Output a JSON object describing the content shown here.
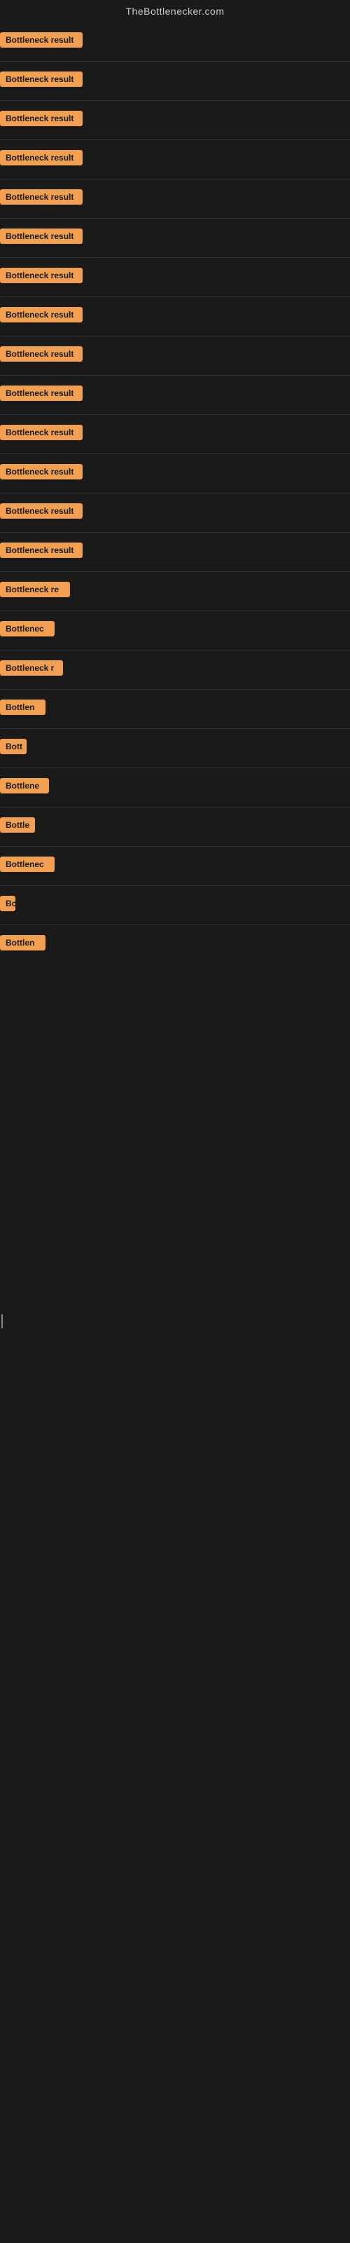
{
  "site": {
    "title": "TheBottlenecker.com"
  },
  "items": [
    {
      "id": 1,
      "label": "Bottleneck result",
      "badge_width": "full"
    },
    {
      "id": 2,
      "label": "Bottleneck result",
      "badge_width": "full"
    },
    {
      "id": 3,
      "label": "Bottleneck result",
      "badge_width": "full"
    },
    {
      "id": 4,
      "label": "Bottleneck result",
      "badge_width": "full"
    },
    {
      "id": 5,
      "label": "Bottleneck result",
      "badge_width": "full"
    },
    {
      "id": 6,
      "label": "Bottleneck result",
      "badge_width": "full"
    },
    {
      "id": 7,
      "label": "Bottleneck result",
      "badge_width": "full"
    },
    {
      "id": 8,
      "label": "Bottleneck result",
      "badge_width": "full"
    },
    {
      "id": 9,
      "label": "Bottleneck result",
      "badge_width": "full"
    },
    {
      "id": 10,
      "label": "Bottleneck result",
      "badge_width": "full"
    },
    {
      "id": 11,
      "label": "Bottleneck result",
      "badge_width": "full"
    },
    {
      "id": 12,
      "label": "Bottleneck result",
      "badge_width": "full"
    },
    {
      "id": 13,
      "label": "Bottleneck result",
      "badge_width": "full"
    },
    {
      "id": 14,
      "label": "Bottleneck result",
      "badge_width": "full"
    },
    {
      "id": 15,
      "label": "Bottleneck re",
      "badge_width": "partial1"
    },
    {
      "id": 16,
      "label": "Bottlenec",
      "badge_width": "partial2"
    },
    {
      "id": 17,
      "label": "Bottleneck r",
      "badge_width": "partial3"
    },
    {
      "id": 18,
      "label": "Bottlen",
      "badge_width": "partial4"
    },
    {
      "id": 19,
      "label": "Bott",
      "badge_width": "partial5"
    },
    {
      "id": 20,
      "label": "Bottlene",
      "badge_width": "partial6"
    },
    {
      "id": 21,
      "label": "Bottle",
      "badge_width": "partial7"
    },
    {
      "id": 22,
      "label": "Bottlenec",
      "badge_width": "partial2"
    },
    {
      "id": 23,
      "label": "Bo",
      "badge_width": "partial8"
    },
    {
      "id": 24,
      "label": "Bottlen",
      "badge_width": "partial4"
    }
  ],
  "colors": {
    "badge_bg": "#f0a050",
    "badge_text": "#1a1a1a",
    "background": "#1a1a1a",
    "title": "#cccccc",
    "divider": "#333333"
  }
}
